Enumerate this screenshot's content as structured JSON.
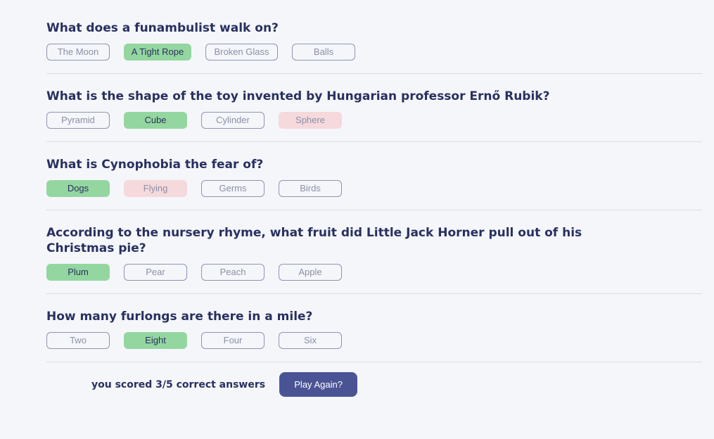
{
  "colors": {
    "background": "#f5f6fa",
    "text": "#283060",
    "correct": "#94d6a0",
    "wrong": "#f6d9dc",
    "button": "#4a5494"
  },
  "questions": [
    {
      "question": "What does a funambulist walk on?",
      "answers": [
        "The Moon",
        "A Tight Rope",
        "Broken Glass",
        "Balls"
      ]
    },
    {
      "question": "What is the shape of the toy invented by Hungarian professor Ernő Rubik?",
      "answers": [
        "Pyramid",
        "Cube",
        "Cylinder",
        "Sphere"
      ]
    },
    {
      "question": "What is Cynophobia the fear of?",
      "answers": [
        "Dogs",
        "Flying",
        "Germs",
        "Birds"
      ]
    },
    {
      "question": "According to the nursery rhyme, what fruit did Little Jack Horner pull out of his Christmas pie?",
      "answers": [
        "Plum",
        "Pear",
        "Peach",
        "Apple"
      ]
    },
    {
      "question": "How many furlongs are there in a mile?",
      "answers": [
        "Two",
        "Eight",
        "Four",
        "Six"
      ]
    }
  ],
  "result": {
    "score_text": "you scored 3/5 correct answers",
    "play_again_label": "Play Again?"
  }
}
